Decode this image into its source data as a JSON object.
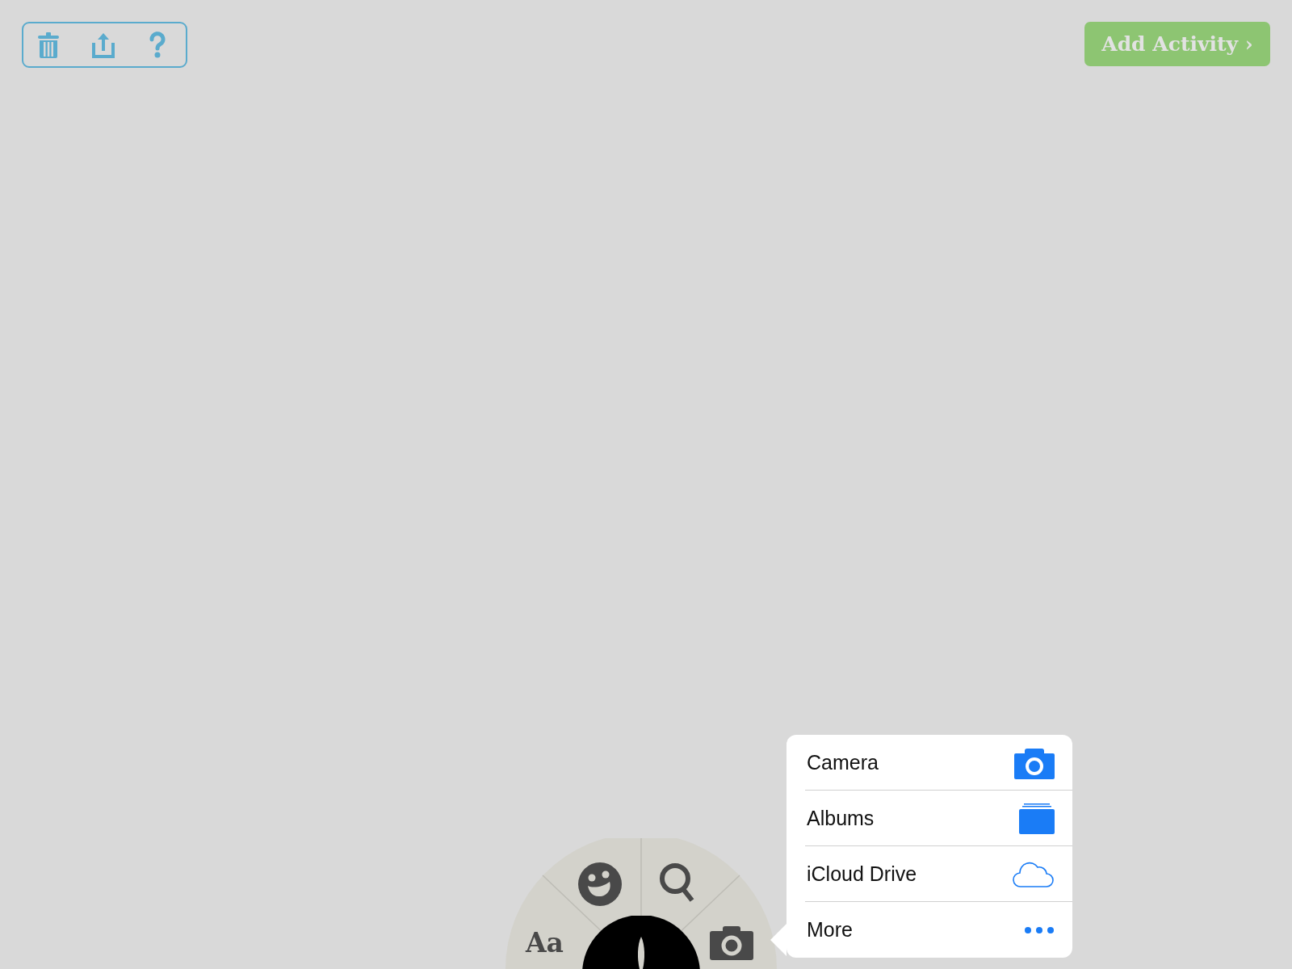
{
  "add_activity": {
    "label": "Add Activity ›"
  },
  "radial_menu": {
    "text_tool": "Aa"
  },
  "source_menu": {
    "items": [
      {
        "label": "Camera"
      },
      {
        "label": "Albums"
      },
      {
        "label": "iCloud Drive"
      },
      {
        "label": "More"
      }
    ]
  }
}
